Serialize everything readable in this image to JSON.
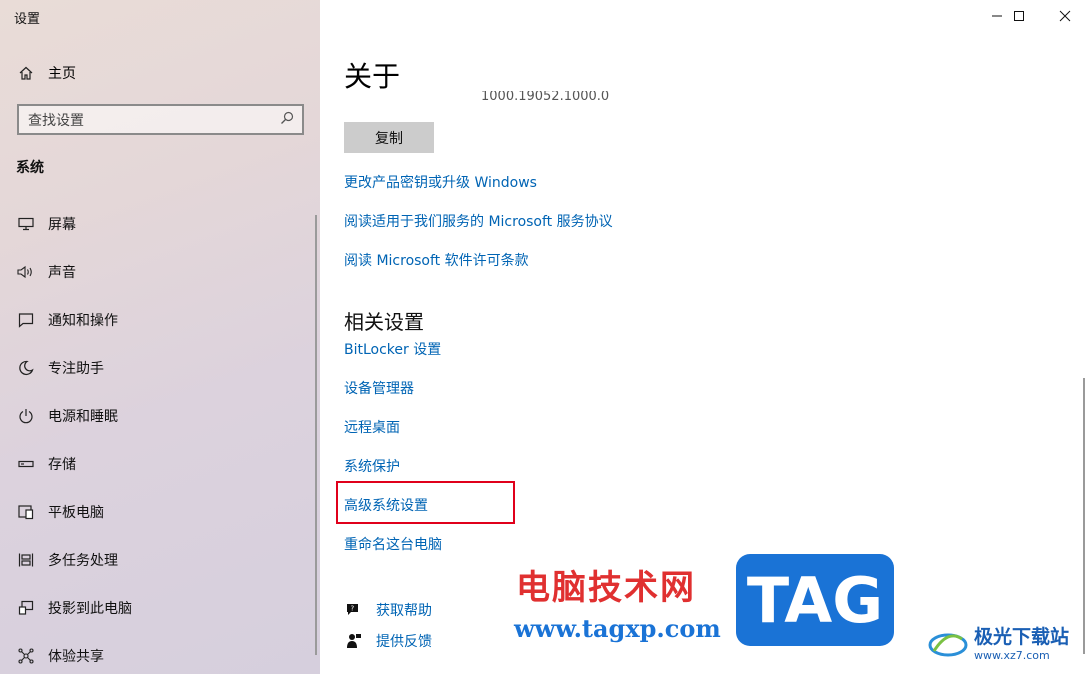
{
  "window": {
    "title": "设置",
    "controls": [
      "minimize",
      "maximize",
      "close"
    ]
  },
  "sidebar": {
    "home_label": "主页",
    "search_placeholder": "查找设置",
    "section_title": "系统",
    "items": [
      {
        "label": "屏幕",
        "icon": "monitor-icon"
      },
      {
        "label": "声音",
        "icon": "speaker-icon"
      },
      {
        "label": "通知和操作",
        "icon": "notification-icon"
      },
      {
        "label": "专注助手",
        "icon": "moon-icon"
      },
      {
        "label": "电源和睡眠",
        "icon": "power-icon"
      },
      {
        "label": "存储",
        "icon": "storage-icon"
      },
      {
        "label": "平板电脑",
        "icon": "tablet-icon"
      },
      {
        "label": "多任务处理",
        "icon": "multitask-icon"
      },
      {
        "label": "投影到此电脑",
        "icon": "project-icon"
      },
      {
        "label": "体验共享",
        "icon": "share-icon"
      }
    ]
  },
  "main": {
    "title": "关于",
    "version_fragment": "1000.19052.1000.0",
    "copy_button": "复制",
    "links": [
      "更改产品密钥或升级 Windows",
      "阅读适用于我们服务的 Microsoft 服务协议",
      "阅读 Microsoft 软件许可条款"
    ],
    "related_title": "相关设置",
    "related_links": [
      "BitLocker 设置",
      "设备管理器",
      "远程桌面",
      "系统保护",
      "高级系统设置",
      "重命名这台电脑"
    ],
    "help": {
      "get_help": "获取帮助",
      "feedback": "提供反馈"
    }
  },
  "watermark": {
    "cn_text": "电脑技术网",
    "url": "www.tagxp.com",
    "tag": "TAG",
    "site_name": "极光下载站",
    "site_url": "www.xz7.com"
  },
  "colors": {
    "link": "#0064b4",
    "highlight_border": "#e0001b"
  }
}
